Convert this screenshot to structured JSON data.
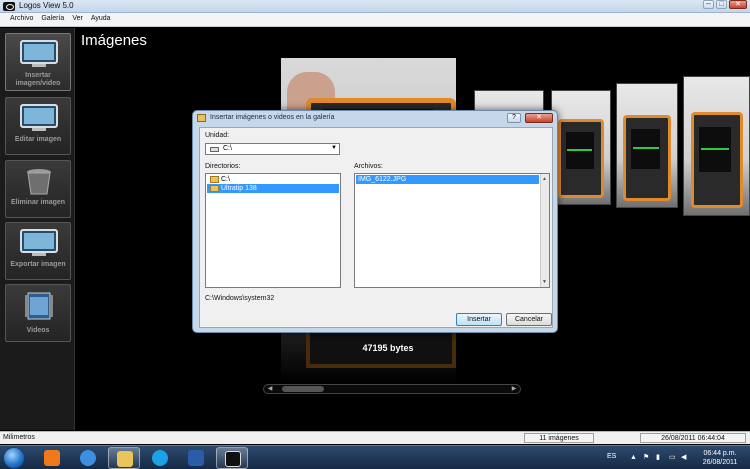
{
  "window": {
    "title": "Logos View 5.0",
    "buttons": [
      "─",
      "□",
      "✕"
    ]
  },
  "menu": [
    "Archivo",
    "Galería",
    "Ver",
    "Ayuda"
  ],
  "sidebar": {
    "items": [
      {
        "label": "Insertar imagen/video",
        "icon": "insert-image-icon",
        "active": true
      },
      {
        "label": "Editar imagen",
        "icon": "edit-image-icon"
      },
      {
        "label": "Eliminar imagen",
        "icon": "trash-icon"
      },
      {
        "label": "Exportar imagen",
        "icon": "export-image-icon"
      },
      {
        "label": "Videos",
        "icon": "videos-icon"
      }
    ]
  },
  "main": {
    "title": "Imágenes",
    "file_size": "47195 bytes"
  },
  "dialog": {
    "title": "Insertar imágenes o videos en la galería",
    "help": "?",
    "close": "✕",
    "drive_label": "Unidad:",
    "drive_value": "C:\\",
    "dirs_label": "Directorios:",
    "dirs": [
      {
        "name": "C:\\",
        "selected": false
      },
      {
        "name": "Ultratip 138",
        "selected": true
      }
    ],
    "files_label": "Archivos:",
    "files": [
      {
        "name": "IMG_6122.JPG",
        "selected": true
      }
    ],
    "path": "C:\\Windows\\system32",
    "insert_button": "Insertar",
    "cancel_button": "Cancelar"
  },
  "statusbar": {
    "left": "Milimetros",
    "count": "11 imágenes",
    "datetime": "26/08/2011 06:44:04"
  },
  "taskbar": {
    "language": "ES",
    "time": "06:44 p.m.",
    "date": "26/08/2011",
    "apps": [
      {
        "name": "media-player-icon",
        "color": "#f07a1a"
      },
      {
        "name": "internet-explorer-icon",
        "color": "#3f8fe0"
      },
      {
        "name": "folder-icon",
        "color": "#e8c45a",
        "active": true
      },
      {
        "name": "skype-icon",
        "color": "#1da1e6"
      },
      {
        "name": "word-icon",
        "color": "#2a5caa"
      },
      {
        "name": "logos-view-icon",
        "color": "#111111",
        "active": true
      }
    ]
  }
}
